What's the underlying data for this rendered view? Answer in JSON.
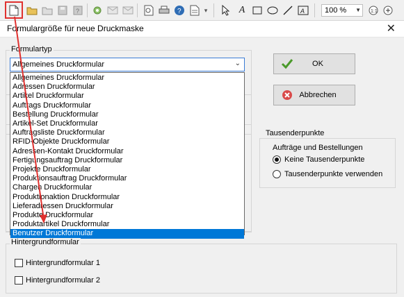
{
  "toolbar": {
    "icons": [
      "new-document-icon",
      "open-folder-icon",
      "open-folder-2-icon",
      "save-icon",
      "save-as-icon",
      "settings-icon",
      "mail-icon",
      "mail-2-icon",
      "print-preview-icon",
      "print-icon",
      "help-icon",
      "document-icon",
      "pointer-icon",
      "text-icon",
      "rectangle-icon",
      "ellipse-icon",
      "line-icon",
      "field-icon"
    ],
    "zoom_value": "100 %"
  },
  "dialog": {
    "title": "Formulargröße für neue Druckmaske",
    "close_glyph": "✕"
  },
  "formulartyp": {
    "legend": "Formulartyp",
    "selected": "Allgemeines Druckformular",
    "options": [
      "Allgemeines Druckformular",
      "Adressen Druckformular",
      "Artikel Druckformular",
      "Auftrags Druckformular",
      "Bestellung Druckformular",
      "Artikel-Set Druckformular",
      "Auftragsliste Druckformular",
      "RFID-Objekte Druckformular",
      "Adressen-Kontakt Druckformular",
      "Fertigungsauftrag Druckformular",
      "Projekte Druckformular",
      "Produktionsauftrag Druckformular",
      "Chargen Druckformular",
      "Produktionaktion Druckformular",
      "Lieferadressen Druckformular",
      "Produkte Druckformular",
      "Produktartikel Druckformular",
      "Benutzer Druckformular"
    ],
    "highlighted_option": "Benutzer Druckformular"
  },
  "buttons": {
    "ok": "OK",
    "cancel": "Abbrechen"
  },
  "tausender": {
    "legend": "Tausenderpunkte",
    "subtitle": "Aufträge und Bestellungen",
    "option_none": "Keine Tausenderpunkte",
    "option_use": "Tausenderpunkte verwenden",
    "selected": "Keine Tausenderpunkte"
  },
  "hintergrund": {
    "legend": "Hintergrundformular",
    "option1": "Hintergrundformular 1",
    "option2": "Hintergrundformular 2"
  },
  "colors": {
    "selection": "#0078d7",
    "annotation": "#e0312f"
  }
}
